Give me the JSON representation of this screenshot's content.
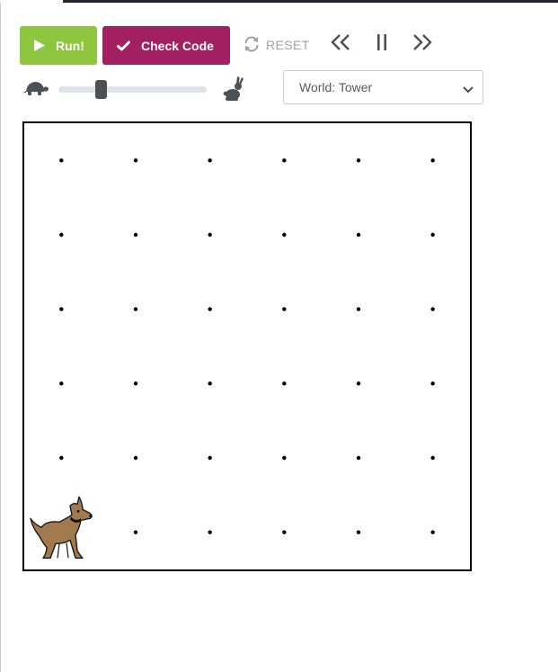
{
  "toolbar": {
    "run_label": "Run!",
    "check_label": "Check Code",
    "reset_label": "RESET",
    "run_color": "#8ec63f",
    "check_color": "#a2205f"
  },
  "speed": {
    "slow_icon": "turtle-icon",
    "fast_icon": "rabbit-icon",
    "level": 0.27
  },
  "world_select": {
    "selected": "World: Tower"
  },
  "world": {
    "columns": 6,
    "rows": 6,
    "character": "dog",
    "character_cell": {
      "col": 0,
      "row": 5
    }
  },
  "icons": [
    "play-icon",
    "check-icon",
    "reset-icon",
    "step-back-icon",
    "pause-icon",
    "step-forward-icon",
    "chevron-down-icon"
  ]
}
